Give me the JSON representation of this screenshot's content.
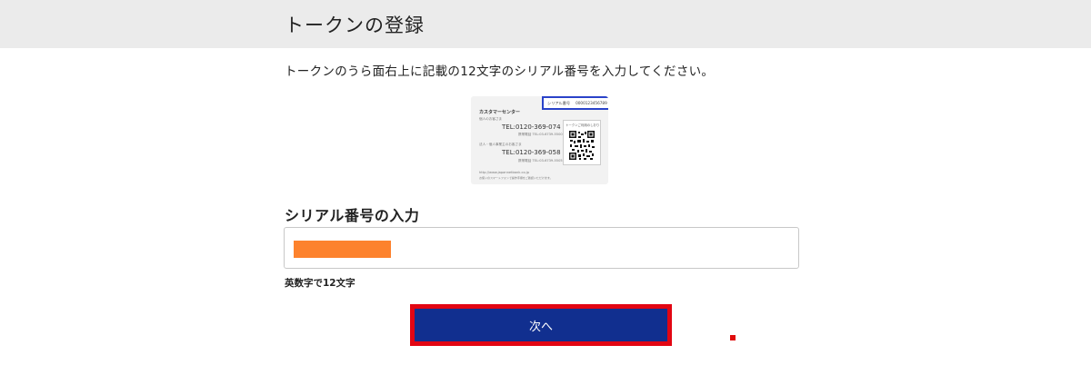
{
  "header": {
    "title": "トークンの登録"
  },
  "instruction": "トークンのうら面右上に記載の12文字のシリアル番号を入力してください。",
  "card": {
    "serial_label": "シリアル番号",
    "serial_value": "0000123456789",
    "center_title": "カスタマーセンター",
    "personal_label": "個人のお客さま",
    "tel_personal": "TEL:0120-369-074",
    "tel_personal_overseas": "携帯電話 TEL:03-6739-5500",
    "corporate_label": "法人・個人事業主のお客さま",
    "tel_corporate": "TEL:0120-369-058",
    "tel_corporate_overseas": "携帯電話 TEL:03-6739-5505",
    "url": "http://www.japannetbank.co.jp",
    "footnote": "お使いのスマートフォンで操作手順をご確認いただけます。",
    "qr_label": "トークンご利用のしおり"
  },
  "form": {
    "section_title": "シリアル番号の入力",
    "hint": "英数字で12文字",
    "next_label": "次へ"
  },
  "colors": {
    "header_bg": "#ebebeb",
    "button_bg": "#112f8f",
    "highlight_red": "#e20613",
    "redaction_orange": "#fd822d",
    "card_serial_border": "#2a43c9"
  }
}
